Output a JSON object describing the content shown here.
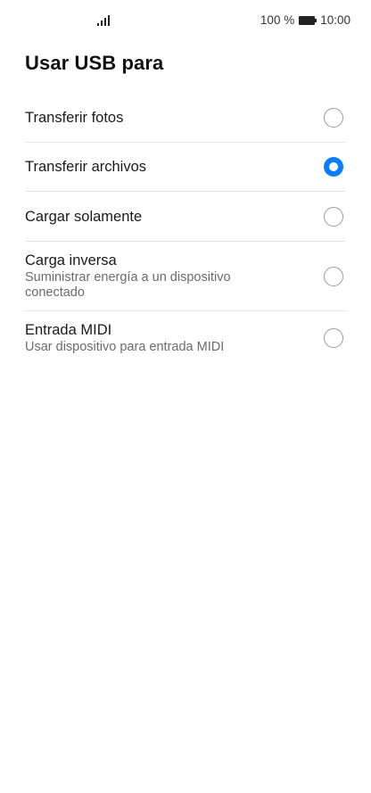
{
  "status_bar": {
    "battery_percent": "100 %",
    "time": "10:00",
    "battery_level": 1.0
  },
  "page": {
    "title": "Usar USB para"
  },
  "options": [
    {
      "label": "Transferir fotos",
      "sublabel": "",
      "selected": false
    },
    {
      "label": "Transferir archivos",
      "sublabel": "",
      "selected": true
    },
    {
      "label": "Cargar solamente",
      "sublabel": "",
      "selected": false
    },
    {
      "label": "Carga inversa",
      "sublabel": "Suministrar energía a un dispositivo conectado",
      "selected": false
    },
    {
      "label": "Entrada MIDI",
      "sublabel": "Usar dispositivo para entrada MIDI",
      "selected": false
    }
  ],
  "colors": {
    "accent": "#0a7cff",
    "divider": "#e6e6e6",
    "secondary_text": "#6b6b6b"
  },
  "icons": {
    "signal": "signal-bars-icon",
    "battery": "battery-icon",
    "radio_checked": "radio-checked-icon",
    "radio_unchecked": "radio-unchecked-icon"
  }
}
